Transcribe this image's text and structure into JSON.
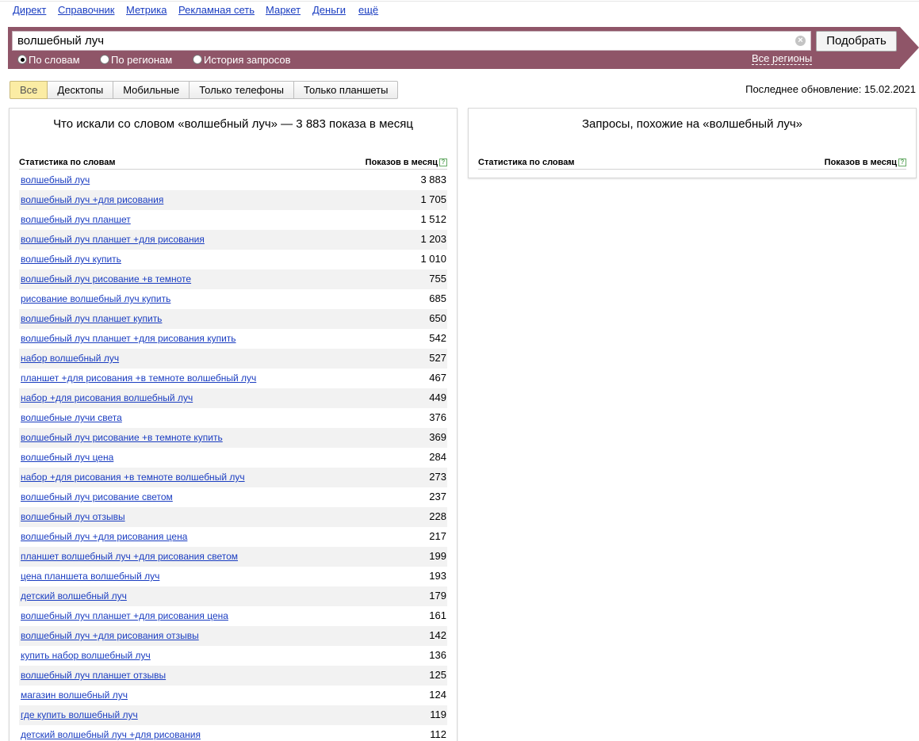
{
  "nav": [
    "Директ",
    "Справочник",
    "Метрика",
    "Рекламная сеть",
    "Маркет",
    "Деньги",
    "ещё"
  ],
  "search": {
    "value": "волшебный луч",
    "button": "Подобрать",
    "clear_icon": "×"
  },
  "modes": [
    {
      "label": "По словам",
      "selected": true
    },
    {
      "label": "По регионам",
      "selected": false
    },
    {
      "label": "История запросов",
      "selected": false
    }
  ],
  "regions_link": "Все регионы",
  "devices": [
    "Все",
    "Десктопы",
    "Мобильные",
    "Только телефоны",
    "Только планшеты"
  ],
  "active_device": "Все",
  "last_update": "Последнее обновление: 15.02.2021",
  "left": {
    "title": "Что искали со словом «волшебный луч» — 3 883 показа в месяц",
    "col_words": "Статистика по словам",
    "col_shows": "Показов в месяц",
    "help_icon": "?",
    "rows": [
      {
        "q": "волшебный луч",
        "n": "3 883"
      },
      {
        "q": "волшебный луч +для рисования",
        "n": "1 705"
      },
      {
        "q": "волшебный луч планшет",
        "n": "1 512"
      },
      {
        "q": "волшебный луч планшет +для рисования",
        "n": "1 203"
      },
      {
        "q": "волшебный луч купить",
        "n": "1 010"
      },
      {
        "q": "волшебный луч рисование +в темноте",
        "n": "755"
      },
      {
        "q": "рисование волшебный луч купить",
        "n": "685"
      },
      {
        "q": "волшебный луч планшет купить",
        "n": "650"
      },
      {
        "q": "волшебный луч планшет +для рисования купить",
        "n": "542"
      },
      {
        "q": "набор волшебный луч",
        "n": "527"
      },
      {
        "q": "планшет +для рисования +в темноте волшебный луч",
        "n": "467"
      },
      {
        "q": "набор +для рисования волшебный луч",
        "n": "449"
      },
      {
        "q": "волшебные лучи света",
        "n": "376"
      },
      {
        "q": "волшебный луч рисование +в темноте купить",
        "n": "369"
      },
      {
        "q": "волшебный луч цена",
        "n": "284"
      },
      {
        "q": "набор +для рисования +в темноте волшебный луч",
        "n": "273"
      },
      {
        "q": "волшебный луч рисование светом",
        "n": "237"
      },
      {
        "q": "волшебный луч отзывы",
        "n": "228"
      },
      {
        "q": "волшебный луч +для рисования цена",
        "n": "217"
      },
      {
        "q": "планшет волшебный луч +для рисования светом",
        "n": "199"
      },
      {
        "q": "цена планшета волшебный луч",
        "n": "193"
      },
      {
        "q": "детский волшебный луч",
        "n": "179"
      },
      {
        "q": "волшебный луч планшет +для рисования цена",
        "n": "161"
      },
      {
        "q": "волшебный луч +для рисования отзывы",
        "n": "142"
      },
      {
        "q": "купить набор волшебный луч",
        "n": "136"
      },
      {
        "q": "волшебный луч планшет отзывы",
        "n": "125"
      },
      {
        "q": "магазин волшебный луч",
        "n": "124"
      },
      {
        "q": "где купить волшебный луч",
        "n": "119"
      },
      {
        "q": "детский волшебный луч +для рисования",
        "n": "112"
      }
    ]
  },
  "right": {
    "title": "Запросы, похожие на «волшебный луч»",
    "col_words": "Статистика по словам",
    "col_shows": "Показов в месяц",
    "help_icon": "?"
  }
}
